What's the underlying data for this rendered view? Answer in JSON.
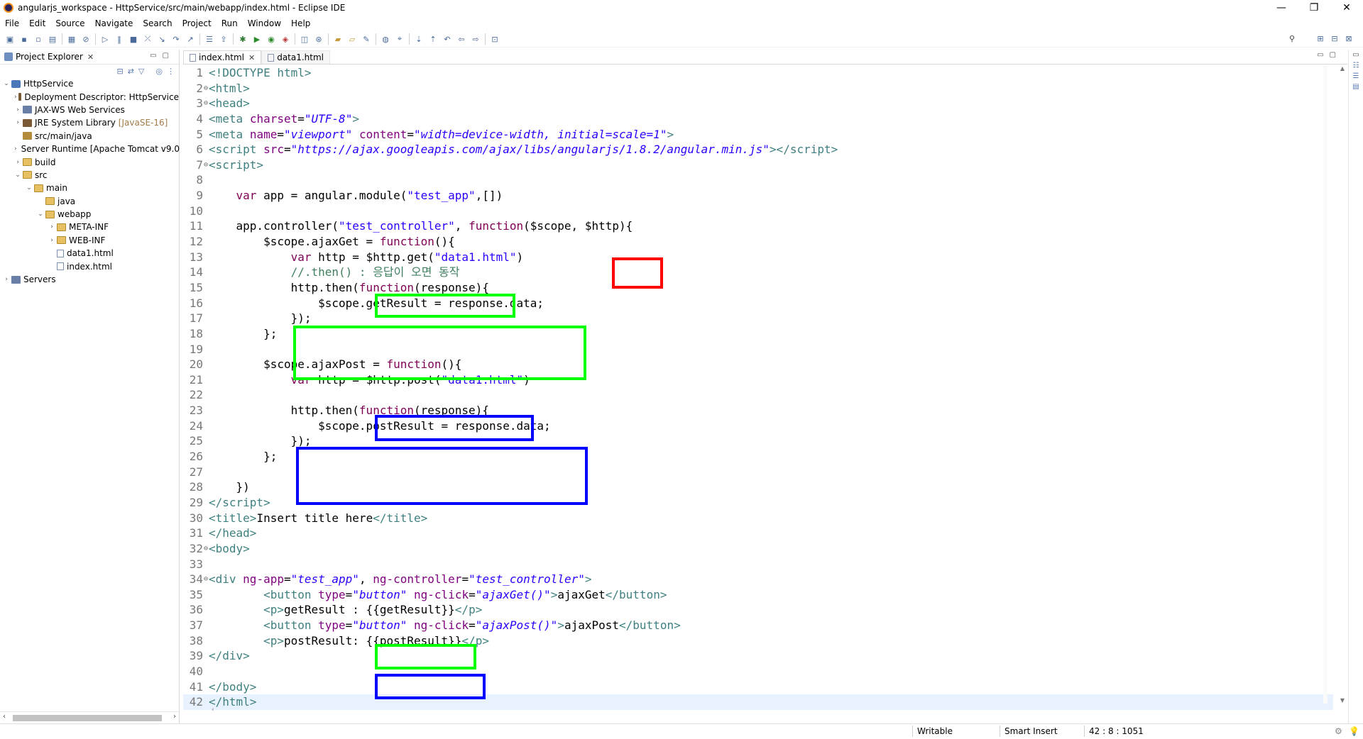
{
  "window": {
    "title": "angularjs_workspace - HttpService/src/main/webapp/index.html - Eclipse IDE",
    "controls": [
      "—",
      "❐",
      "✕"
    ]
  },
  "menu": [
    "File",
    "Edit",
    "Source",
    "Navigate",
    "Search",
    "Project",
    "Run",
    "Window",
    "Help"
  ],
  "project_explorer": {
    "tab_label": "Project Explorer",
    "tree": [
      {
        "label": "HttpService",
        "depth": 0,
        "arrow": "⌄",
        "icon": "proj"
      },
      {
        "label": "Deployment Descriptor: HttpService",
        "depth": 1,
        "arrow": "›",
        "icon": "jar"
      },
      {
        "label": "JAX-WS Web Services",
        "depth": 1,
        "arrow": "›",
        "icon": "srv"
      },
      {
        "label": "JRE System Library",
        "suffix": "[JavaSE-16]",
        "depth": 1,
        "arrow": "›",
        "icon": "jar"
      },
      {
        "label": "src/main/java",
        "depth": 1,
        "arrow": "",
        "icon": "pkg"
      },
      {
        "label": "Server Runtime [Apache Tomcat v9.0",
        "depth": 1,
        "arrow": "›",
        "icon": "jar"
      },
      {
        "label": "build",
        "depth": 1,
        "arrow": "›",
        "icon": "fold"
      },
      {
        "label": "src",
        "depth": 1,
        "arrow": "⌄",
        "icon": "fold"
      },
      {
        "label": "main",
        "depth": 2,
        "arrow": "⌄",
        "icon": "fold"
      },
      {
        "label": "java",
        "depth": 3,
        "arrow": "",
        "icon": "fold"
      },
      {
        "label": "webapp",
        "depth": 3,
        "arrow": "⌄",
        "icon": "fold"
      },
      {
        "label": "META-INF",
        "depth": 4,
        "arrow": "›",
        "icon": "fold"
      },
      {
        "label": "WEB-INF",
        "depth": 4,
        "arrow": "›",
        "icon": "fold"
      },
      {
        "label": "data1.html",
        "depth": 4,
        "arrow": "",
        "icon": "file"
      },
      {
        "label": "index.html",
        "depth": 4,
        "arrow": "",
        "icon": "file"
      },
      {
        "label": "Servers",
        "depth": 0,
        "arrow": "›",
        "icon": "srv"
      }
    ]
  },
  "editor": {
    "tabs": [
      {
        "label": "index.html",
        "active": true
      },
      {
        "label": "data1.html",
        "active": false
      }
    ],
    "lines": [
      {
        "n": "1",
        "fold": "",
        "html": "<span class=\"tag\">&lt;!DOCTYPE html&gt;</span>"
      },
      {
        "n": "2",
        "fold": "⊖",
        "html": "<span class=\"tag\">&lt;html&gt;</span>"
      },
      {
        "n": "3",
        "fold": "⊖",
        "html": "<span class=\"tag\">&lt;head&gt;</span>"
      },
      {
        "n": "4",
        "fold": "",
        "html": "<span class=\"tag\">&lt;meta</span> <span class=\"att\">charset</span>=<span class=\"str\">\"UTF-8\"</span><span class=\"tag\">&gt;</span>"
      },
      {
        "n": "5",
        "fold": "",
        "html": "<span class=\"tag\">&lt;meta</span> <span class=\"att\">name</span>=<span class=\"str\">\"viewport\"</span> <span class=\"att\">content</span>=<span class=\"str\">\"width=device-width, initial=scale=1\"</span><span class=\"tag\">&gt;</span>"
      },
      {
        "n": "6",
        "fold": "",
        "html": "<span class=\"tag\">&lt;script</span> <span class=\"att\">src</span>=<span class=\"str\">\"https://ajax.googleapis.com/ajax/libs/angularjs/1.8.2/angular.min.js\"</span><span class=\"tag\">&gt;&lt;/script&gt;</span>"
      },
      {
        "n": "7",
        "fold": "⊖",
        "html": "<span class=\"tag\">&lt;script&gt;</span>"
      },
      {
        "n": "8",
        "fold": "",
        "html": ""
      },
      {
        "n": "9",
        "fold": "",
        "html": "    <span class=\"kw\">var</span> app = angular.module(<span class=\"js\">\"test_app\"</span>,[])"
      },
      {
        "n": "10",
        "fold": "",
        "html": ""
      },
      {
        "n": "11",
        "fold": "",
        "html": "    app.controller(<span class=\"js\">\"test_controller\"</span>, <span class=\"kw\">function</span>($scope, $http){"
      },
      {
        "n": "12",
        "fold": "",
        "html": "        $scope.ajaxGet = <span class=\"kw\">function</span>(){"
      },
      {
        "n": "13",
        "fold": "",
        "html": "            <span class=\"kw\">var</span> http = $http.get(<span class=\"js\">\"data1.html\"</span>)"
      },
      {
        "n": "14",
        "fold": "",
        "html": "            <span class=\"cm\">//.then() : 응답이 오면 동작</span>"
      },
      {
        "n": "15",
        "fold": "",
        "html": "            http.then(<span class=\"kw\">function</span>(response){"
      },
      {
        "n": "16",
        "fold": "",
        "html": "                $scope.getResult = response.data;"
      },
      {
        "n": "17",
        "fold": "",
        "html": "            });"
      },
      {
        "n": "18",
        "fold": "",
        "html": "        };"
      },
      {
        "n": "19",
        "fold": "",
        "html": ""
      },
      {
        "n": "20",
        "fold": "",
        "html": "        $scope.ajaxPost = <span class=\"kw\">function</span>(){"
      },
      {
        "n": "21",
        "fold": "",
        "html": "            <span class=\"kw\">var</span> http = $http.post(<span class=\"js\">\"data1.html\"</span>)"
      },
      {
        "n": "22",
        "fold": "",
        "html": ""
      },
      {
        "n": "23",
        "fold": "",
        "html": "            http.then(<span class=\"kw\">function</span>(response){"
      },
      {
        "n": "24",
        "fold": "",
        "html": "                $scope.postResult = response.data;"
      },
      {
        "n": "25",
        "fold": "",
        "html": "            });"
      },
      {
        "n": "26",
        "fold": "",
        "html": "        };"
      },
      {
        "n": "27",
        "fold": "",
        "html": ""
      },
      {
        "n": "28",
        "fold": "",
        "html": "    })"
      },
      {
        "n": "29",
        "fold": "",
        "html": "<span class=\"tag\">&lt;/script&gt;</span>"
      },
      {
        "n": "30",
        "fold": "",
        "html": "<span class=\"tag\">&lt;title&gt;</span>Insert title here<span class=\"tag\">&lt;/title&gt;</span>"
      },
      {
        "n": "31",
        "fold": "",
        "html": "<span class=\"tag\">&lt;/head&gt;</span>"
      },
      {
        "n": "32",
        "fold": "⊖",
        "html": "<span class=\"tag\">&lt;body&gt;</span>"
      },
      {
        "n": "33",
        "fold": "",
        "html": ""
      },
      {
        "n": "34",
        "fold": "⊖",
        "html": "<span class=\"tag\">&lt;div</span> <span class=\"att\">ng-app</span>=<span class=\"str\">\"test_app\"</span>, <span class=\"att\">ng-controller</span>=<span class=\"str\">\"test_controller\"</span><span class=\"tag\">&gt;</span>"
      },
      {
        "n": "35",
        "fold": "",
        "html": "        <span class=\"tag\">&lt;button</span> <span class=\"att\">type</span>=<span class=\"str\">\"button\"</span> <span class=\"att\">ng-click</span>=<span class=\"str\">\"ajaxGet()\"</span><span class=\"tag\">&gt;</span>ajaxGet<span class=\"tag\">&lt;/button&gt;</span>"
      },
      {
        "n": "36",
        "fold": "",
        "html": "        <span class=\"tag\">&lt;p&gt;</span>getResult : {{getResult}}<span class=\"tag\">&lt;/p&gt;</span>"
      },
      {
        "n": "37",
        "fold": "",
        "html": "        <span class=\"tag\">&lt;button</span> <span class=\"att\">type</span>=<span class=\"str\">\"button\"</span> <span class=\"att\">ng-click</span>=<span class=\"str\">\"ajaxPost()\"</span><span class=\"tag\">&gt;</span>ajaxPost<span class=\"tag\">&lt;/button&gt;</span>"
      },
      {
        "n": "38",
        "fold": "",
        "html": "        <span class=\"tag\">&lt;p&gt;</span>postResult: {{postResult}}<span class=\"tag\">&lt;/p&gt;</span>"
      },
      {
        "n": "39",
        "fold": "",
        "html": "<span class=\"tag\">&lt;/div&gt;</span>"
      },
      {
        "n": "40",
        "fold": "",
        "html": ""
      },
      {
        "n": "41",
        "fold": "",
        "html": "<span class=\"tag\">&lt;/body&gt;</span>"
      },
      {
        "n": "42",
        "fold": "",
        "html": "<span class=\"tag\">&lt;/html&gt;</span>"
      }
    ]
  },
  "status": {
    "writable": "Writable",
    "insert_mode": "Smart Insert",
    "position": "42 : 8 : 1051"
  },
  "colors": {
    "highlight_red": "#ff0000",
    "highlight_green": "#00ff00",
    "highlight_blue": "#0000ff"
  }
}
